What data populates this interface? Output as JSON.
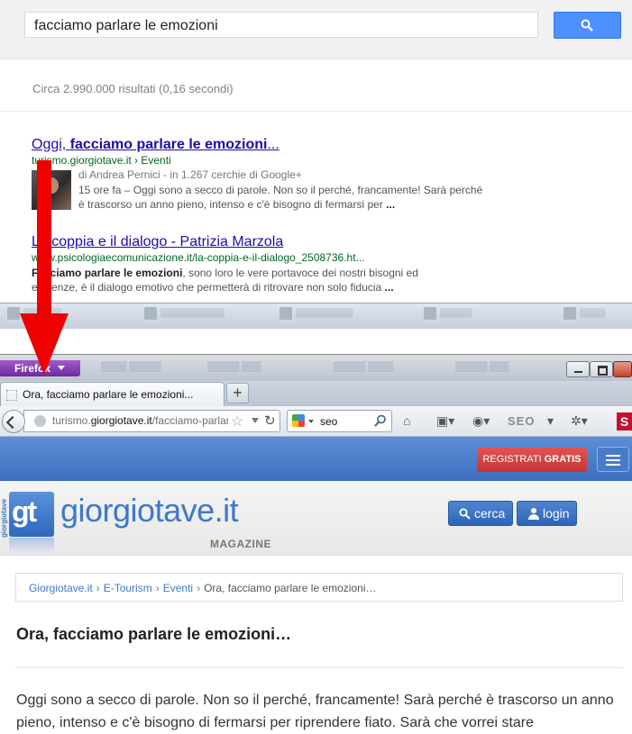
{
  "google": {
    "search_query": "facciamo parlare le emozioni",
    "stats": "Circa 2.990.000 risultati (0,16 secondi)",
    "results": [
      {
        "title_pre": "Oggi, ",
        "title_bold": "facciamo parlare le emozioni",
        "title_post": "...",
        "url": "turismo.giorgiotave.it › Eventi",
        "author": "di Andrea Pernici - in 1.267 cerchie di Google+",
        "snippet_pre": "15 ore fa – Oggi sono a secco di parole. Non so il perché, francamente! Sarà perché è trascorso un anno pieno, intenso e c'è bisogno di fermarsi per ",
        "snippet_bold": "..."
      },
      {
        "title": "La coppia e il dialogo - Patrizia Marzola",
        "url": "www.psicologiaecomunicazione.it/la-coppia-e-il-dialogo_2508736.ht...",
        "snippet_bold": "Facciamo parlare le emozioni",
        "snippet_mid": ", sono loro le vere portavoce dei nostri bisogni ed esigenze, è il dialogo emotivo che permetterà di ritrovare non solo fiducia ",
        "snippet_end": "..."
      }
    ]
  },
  "firefox": {
    "app_button": "Firefox",
    "tab_title": "Ora, facciamo parlare le emozioni...",
    "new_tab": "+",
    "url_domain_pre": "turismo.",
    "url_domain": "giorgiotave.it",
    "url_path": "/facciamo-parlare-le-emozioni",
    "search_value": "seo",
    "toolbar_seo": "SEO",
    "toolbar_s": "S"
  },
  "site": {
    "register_label": "REGISTRATI",
    "register_bold": "GRATIS",
    "logo_mark": "gt",
    "logo_vertical": "giorgiotave",
    "logo_text": "giorgiotave.it",
    "logo_sub": "MAGAZINE",
    "search_button": "cerca",
    "login_button": "login",
    "breadcrumb": [
      "Giorgiotave.it",
      "E-Tourism",
      "Eventi"
    ],
    "breadcrumb_current": "Ora, facciamo parlare le emozioni…",
    "breadcrumb_sep": "›",
    "article_title": "Ora, facciamo parlare le emozioni…",
    "article_body": "Oggi sono a secco di parole. Non so il perché, francamente! Sarà perché è trascorso un anno pieno, intenso e c'è bisogno di fermarsi per riprendere fiato. Sarà che vorrei stare"
  },
  "colors": {
    "google_link": "#1a0dab",
    "google_url": "#006621",
    "site_blue": "#3f78c9",
    "register_red": "#d03e3e",
    "annotation_arrow": "#ee0000"
  }
}
